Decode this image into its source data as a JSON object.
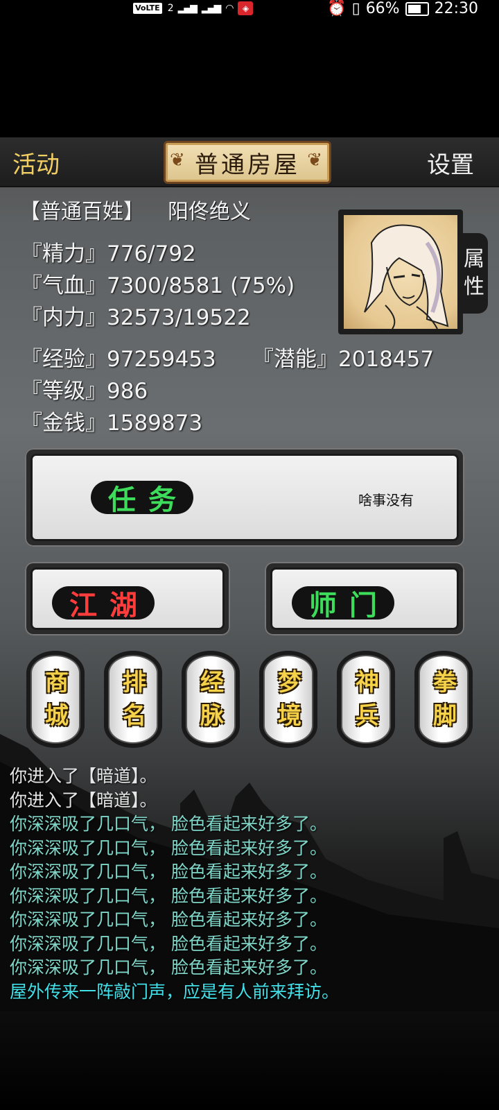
{
  "status_bar": {
    "volte": "VoLTE",
    "sim": "2",
    "net1": "4G",
    "net2": "4G",
    "battery": "66%",
    "time": "22:30"
  },
  "header": {
    "left": "活动",
    "title": "普通房屋",
    "right": "设置"
  },
  "profile": {
    "rank": "【普通百姓】",
    "name": "阳佟绝义",
    "attr_tab": [
      "属",
      "性"
    ]
  },
  "stats": {
    "jingli": {
      "label": "『精力』",
      "value": "776/792"
    },
    "qixue": {
      "label": "『气血』",
      "value": "7300/8581 (75%)"
    },
    "neili": {
      "label": "『内力』",
      "value": "32573/19522"
    },
    "jingyan": {
      "label": "『经验』",
      "value": "97259453"
    },
    "qianneng": {
      "label": "『潜能』",
      "value": "2018457"
    },
    "dengji": {
      "label": "『等级』",
      "value": "986"
    },
    "jinqian": {
      "label": "『金钱』",
      "value": "1589873"
    }
  },
  "task": {
    "label": "任务",
    "status": "啥事没有"
  },
  "buttons": {
    "jianghu": "江湖",
    "shimen": "师门"
  },
  "scrolls": [
    "商城",
    "排名",
    "经脉",
    "梦境",
    "神兵",
    "拳脚"
  ],
  "log": [
    {
      "text": "你进入了【暗道】。",
      "color": "white"
    },
    {
      "text": "你进入了【暗道】。",
      "color": "white"
    },
    {
      "text": "你深深吸了几口气， 脸色看起来好多了。",
      "color": "teal"
    },
    {
      "text": "你深深吸了几口气， 脸色看起来好多了。",
      "color": "teal"
    },
    {
      "text": "你深深吸了几口气， 脸色看起来好多了。",
      "color": "teal"
    },
    {
      "text": "你深深吸了几口气， 脸色看起来好多了。",
      "color": "teal"
    },
    {
      "text": "你深深吸了几口气， 脸色看起来好多了。",
      "color": "teal"
    },
    {
      "text": "你深深吸了几口气， 脸色看起来好多了。",
      "color": "teal"
    },
    {
      "text": "你深深吸了几口气， 脸色看起来好多了。",
      "color": "teal"
    },
    {
      "text": "屋外传来一阵敲门声，应是有人前来拜访。",
      "color": "cyan"
    }
  ]
}
